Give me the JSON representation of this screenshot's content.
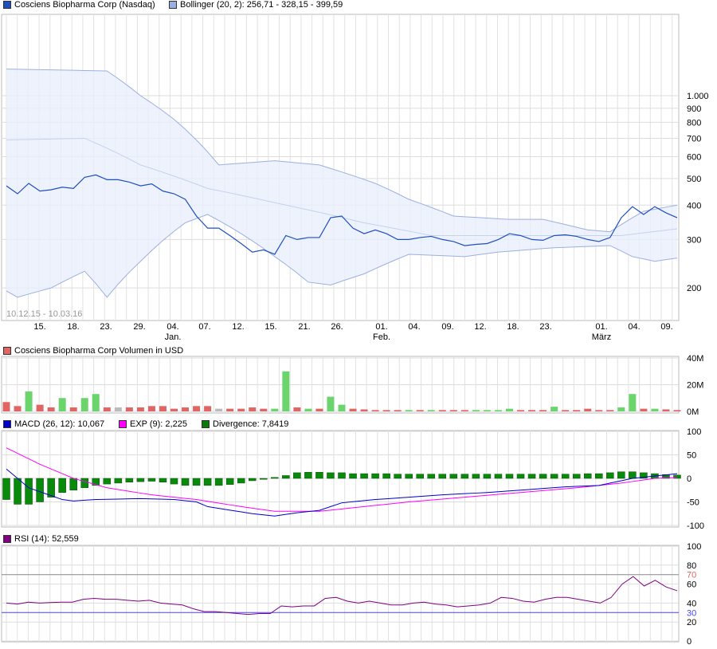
{
  "legends": {
    "price": "Cosciens Biopharma Corp (Nasdaq)",
    "bollinger": "Bollinger (20, 2): 256,71 - 328,15 - 399,59",
    "volume": "Cosciens Biopharma Corp Volumen in USD",
    "macd": "MACD (26, 12): 10,067",
    "exp": "EXP (9): 2,225",
    "divergence": "Divergence: 7,8419",
    "rsi": "RSI (14): 52,559",
    "range": "10.12.15 - 10.03.16"
  },
  "colors": {
    "price": "#1f4fbf",
    "band": "#9bb0e0",
    "bandfill": "#e8effc",
    "volup": "#6cd46c",
    "voldown": "#e06666",
    "volflat": "#bbbbbb",
    "macd": "#0000cc",
    "exp": "#ff00ff",
    "div": "#0a7a0a",
    "rsi": "#800080"
  },
  "chart_data": [
    {
      "type": "line",
      "title": "Cosciens Biopharma Corp (Nasdaq)",
      "yscale": "log",
      "ylim": [
        150,
        1400
      ],
      "yticks": [
        "1.000",
        "900",
        "800",
        "700",
        "600",
        "500",
        "400",
        "300",
        "200"
      ],
      "ytick_values": [
        1000,
        900,
        800,
        700,
        600,
        500,
        400,
        300,
        200
      ],
      "xticks": [
        "15.",
        "18.",
        "23.",
        "29.",
        "04.",
        "07.",
        "12.",
        "15.",
        "21.",
        "26.",
        "01.",
        "04.",
        "09.",
        "12.",
        "18.",
        "23.",
        "01.",
        "04.",
        "09."
      ],
      "month_labels": [
        "Jan.",
        "Feb.",
        "März"
      ],
      "series": [
        {
          "name": "price",
          "values": [
            470,
            440,
            480,
            450,
            455,
            465,
            460,
            505,
            515,
            495,
            495,
            485,
            470,
            478,
            450,
            440,
            420,
            365,
            330,
            330,
            310,
            290,
            270,
            275,
            265,
            310,
            300,
            305,
            305,
            360,
            365,
            330,
            315,
            325,
            315,
            300,
            300,
            305,
            308,
            300,
            295,
            285,
            288,
            290,
            300,
            315,
            310,
            300,
            298,
            310,
            312,
            308,
            300,
            295,
            305,
            360,
            395,
            370,
            395,
            375,
            360
          ]
        },
        {
          "name": "bollinger_upper",
          "keyframes": [
            [
              0,
              1250
            ],
            [
              9,
              1230
            ],
            [
              12,
              1000
            ],
            [
              15,
              820
            ],
            [
              19,
              560
            ],
            [
              24,
              580
            ],
            [
              28,
              560
            ],
            [
              33,
              480
            ],
            [
              36,
              420
            ],
            [
              40,
              365
            ],
            [
              45,
              355
            ],
            [
              48,
              355
            ],
            [
              52,
              325
            ],
            [
              54,
              320
            ],
            [
              57,
              380
            ],
            [
              60,
              400
            ]
          ]
        },
        {
          "name": "bollinger_mid",
          "keyframes": [
            [
              0,
              690
            ],
            [
              7,
              700
            ],
            [
              12,
              560
            ],
            [
              18,
              460
            ],
            [
              25,
              400
            ],
            [
              32,
              345
            ],
            [
              38,
              310
            ],
            [
              55,
              310
            ],
            [
              60,
              328
            ]
          ]
        },
        {
          "name": "bollinger_lower",
          "keyframes": [
            [
              0,
              195
            ],
            [
              1,
              185
            ],
            [
              4,
              200
            ],
            [
              7,
              230
            ],
            [
              9,
              185
            ],
            [
              12,
              250
            ],
            [
              16,
              345
            ],
            [
              18,
              370
            ],
            [
              24,
              260
            ],
            [
              27,
              210
            ],
            [
              29,
              205
            ],
            [
              32,
              225
            ],
            [
              36,
              265
            ],
            [
              41,
              260
            ],
            [
              44,
              270
            ],
            [
              49,
              280
            ],
            [
              54,
              285
            ],
            [
              56,
              260
            ],
            [
              58,
              250
            ],
            [
              60,
              257
            ]
          ]
        }
      ]
    },
    {
      "type": "bar",
      "title": "Cosciens Biopharma Corp Volumen in USD",
      "ylim": [
        0,
        40
      ],
      "yticks": [
        "40M",
        "20M",
        "0M"
      ],
      "ytick_values": [
        40,
        20,
        0
      ],
      "values": [
        7,
        4,
        15,
        5,
        3,
        10,
        3,
        10,
        13,
        3,
        3,
        3,
        3,
        4,
        4,
        2,
        3,
        4,
        4,
        2,
        2,
        2,
        3,
        2,
        2,
        30,
        3,
        2,
        2,
        11,
        5,
        2,
        1.5,
        1,
        1,
        1,
        1,
        1,
        1,
        1,
        1,
        1,
        1,
        1,
        1,
        2,
        1,
        1,
        1,
        3.5,
        1,
        1,
        2,
        1,
        1,
        3,
        13,
        2,
        2,
        1.5,
        1
      ],
      "directions": [
        "d",
        "d",
        "u",
        "d",
        "d",
        "u",
        "d",
        "u",
        "u",
        "d",
        "f",
        "d",
        "d",
        "d",
        "d",
        "d",
        "d",
        "d",
        "d",
        "f",
        "d",
        "d",
        "d",
        "d",
        "u",
        "u",
        "d",
        "u",
        "d",
        "u",
        "u",
        "d",
        "d",
        "d",
        "d",
        "d",
        "u",
        "d",
        "u",
        "d",
        "d",
        "d",
        "u",
        "u",
        "u",
        "u",
        "d",
        "d",
        "d",
        "u",
        "d",
        "d",
        "d",
        "d",
        "d",
        "u",
        "u",
        "d",
        "u",
        "d",
        "d"
      ]
    },
    {
      "type": "bar+line",
      "title": "MACD",
      "ylim": [
        -100,
        100
      ],
      "yticks": [
        "100",
        "50",
        "0",
        "-50",
        "-100"
      ],
      "ytick_values": [
        100,
        50,
        0,
        -50,
        -100
      ],
      "macd_keyframes": [
        [
          0,
          20
        ],
        [
          2,
          -20
        ],
        [
          5,
          -45
        ],
        [
          6,
          -48
        ],
        [
          8,
          -45
        ],
        [
          12,
          -43
        ],
        [
          15,
          -45
        ],
        [
          17,
          -50
        ],
        [
          18,
          -60
        ],
        [
          22,
          -75
        ],
        [
          24,
          -80
        ],
        [
          26,
          -73
        ],
        [
          28,
          -68
        ],
        [
          30,
          -52
        ],
        [
          33,
          -45
        ],
        [
          36,
          -40
        ],
        [
          39,
          -35
        ],
        [
          43,
          -30
        ],
        [
          46,
          -25
        ],
        [
          50,
          -18
        ],
        [
          53,
          -15
        ],
        [
          56,
          0
        ],
        [
          58,
          5
        ],
        [
          60,
          10
        ]
      ],
      "exp_keyframes": [
        [
          0,
          65
        ],
        [
          3,
          30
        ],
        [
          6,
          0
        ],
        [
          9,
          -20
        ],
        [
          13,
          -35
        ],
        [
          17,
          -45
        ],
        [
          21,
          -60
        ],
        [
          24,
          -70
        ],
        [
          28,
          -70
        ],
        [
          32,
          -60
        ],
        [
          36,
          -50
        ],
        [
          41,
          -40
        ],
        [
          46,
          -30
        ],
        [
          51,
          -20
        ],
        [
          55,
          -10
        ],
        [
          58,
          0
        ],
        [
          60,
          2
        ]
      ],
      "divergence": [
        -45,
        -55,
        -55,
        -50,
        -40,
        -30,
        -25,
        -20,
        -15,
        -12,
        -10,
        -8,
        -7,
        -6,
        -8,
        -12,
        -15,
        -15,
        -15,
        -15,
        -13,
        -10,
        -5,
        -2,
        2,
        6,
        12,
        13,
        13,
        12,
        12,
        10,
        10,
        10,
        10,
        9,
        9,
        9,
        9,
        9,
        9,
        9,
        9,
        9,
        9,
        9,
        9,
        9,
        9,
        9,
        9,
        9,
        10,
        10,
        12,
        14,
        14,
        12,
        10,
        8,
        7
      ]
    },
    {
      "type": "line",
      "title": "RSI (14)",
      "ylim": [
        0,
        100
      ],
      "yticks": [
        "100",
        "80",
        "70",
        "60",
        "40",
        "30",
        "20",
        "0"
      ],
      "ytick_values": [
        100,
        80,
        70,
        60,
        40,
        30,
        20,
        0
      ],
      "values": [
        40,
        39,
        41,
        40,
        40.5,
        41,
        41,
        44,
        45,
        44,
        44,
        43,
        42,
        43,
        40,
        39,
        38,
        34,
        31,
        31,
        30,
        29,
        28,
        29,
        29,
        37,
        36,
        37,
        37,
        45,
        46,
        42,
        40,
        42,
        40,
        38,
        38,
        40,
        41,
        39,
        38,
        36,
        37,
        38,
        40,
        46,
        45,
        42,
        41,
        44,
        46,
        46,
        44,
        42,
        40,
        46,
        60,
        68,
        58,
        64,
        57,
        53
      ],
      "reference_lines": [
        70,
        30
      ]
    }
  ]
}
